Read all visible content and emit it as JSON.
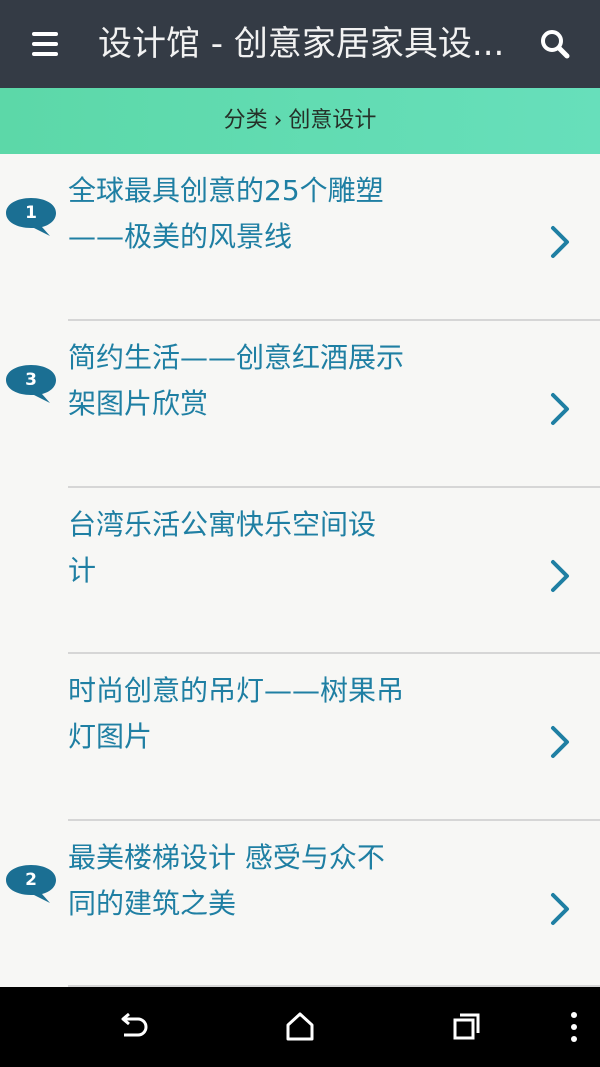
{
  "header": {
    "title": "设计馆 - 创意家居家具设...",
    "menu_icon": "hamburger-menu-icon",
    "search_icon": "search-icon",
    "background": "#343b45"
  },
  "breadcrumb": {
    "root": "分类",
    "separator": "›",
    "current": "创意设计",
    "background": "#5cd8a8"
  },
  "articles": [
    {
      "title_line1": "全球最具创意的25个雕塑",
      "title_line2": "——极美的风景线",
      "comment_count": "1"
    },
    {
      "title_line1": "简约生活——创意红酒展示",
      "title_line2": "架图片欣赏",
      "comment_count": "3"
    },
    {
      "title_line1": "台湾乐活公寓快乐空间设",
      "title_line2": "计",
      "comment_count": ""
    },
    {
      "title_line1": "时尚创意的吊灯——树果吊",
      "title_line2": "灯图片",
      "comment_count": ""
    },
    {
      "title_line1": "最美楼梯设计 感受与众不",
      "title_line2": "同的建筑之美",
      "comment_count": "2"
    }
  ],
  "colors": {
    "link": "#1f7fa3",
    "badge": "#1b6f93",
    "chevron": "#1f7fa3"
  },
  "system_nav": {
    "back_icon": "back-icon",
    "home_icon": "home-icon",
    "recents_icon": "recents-icon",
    "overflow_icon": "more-vert-icon"
  }
}
